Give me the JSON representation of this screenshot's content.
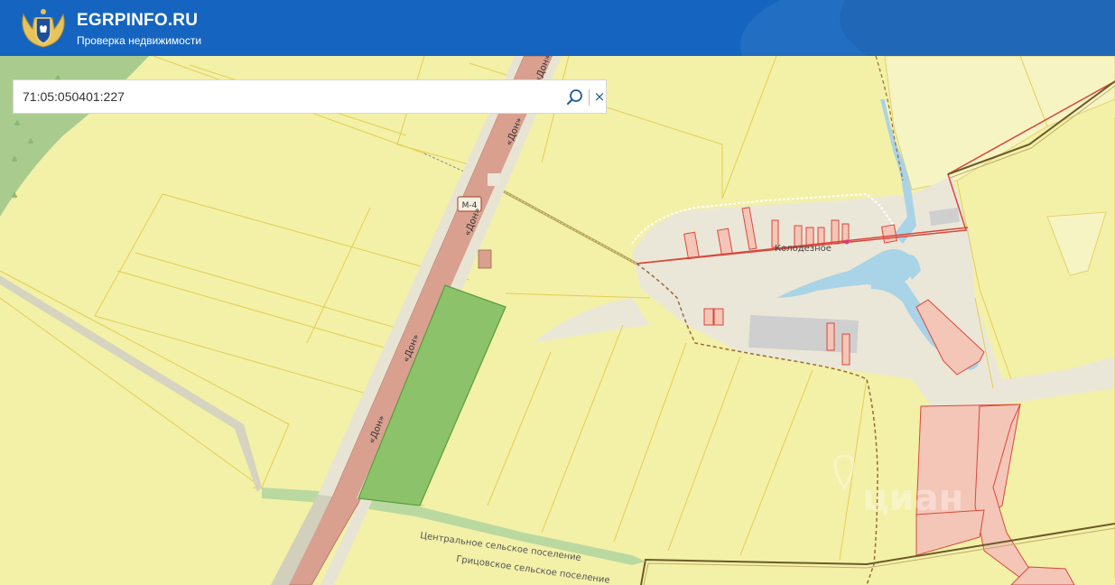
{
  "header": {
    "brand": "EGRPINFO.RU",
    "subtitle": "Проверка недвижимости",
    "logo_icon": "eagle-emblem-icon"
  },
  "search": {
    "value": "71:05:050401:227",
    "search_icon": "search-icon",
    "clear_icon": "close-icon",
    "clear_glyph": "×"
  },
  "map": {
    "road_labels": [
      "«Дон»",
      "«Дон»",
      "«Дон»",
      "«Дон»",
      "«Дон»"
    ],
    "highway_badge": "М-4",
    "village_label": "Колодезное",
    "boundary_labels": [
      "Центральное сельское поселение",
      "Грицовское сельское поселение"
    ],
    "watermark": "циан",
    "colors": {
      "field": "#f3f0a8",
      "road": "#d9a090",
      "selected_parcel": "#8cc26a",
      "water": "#a9d3e6",
      "header": "#1565c0"
    }
  }
}
